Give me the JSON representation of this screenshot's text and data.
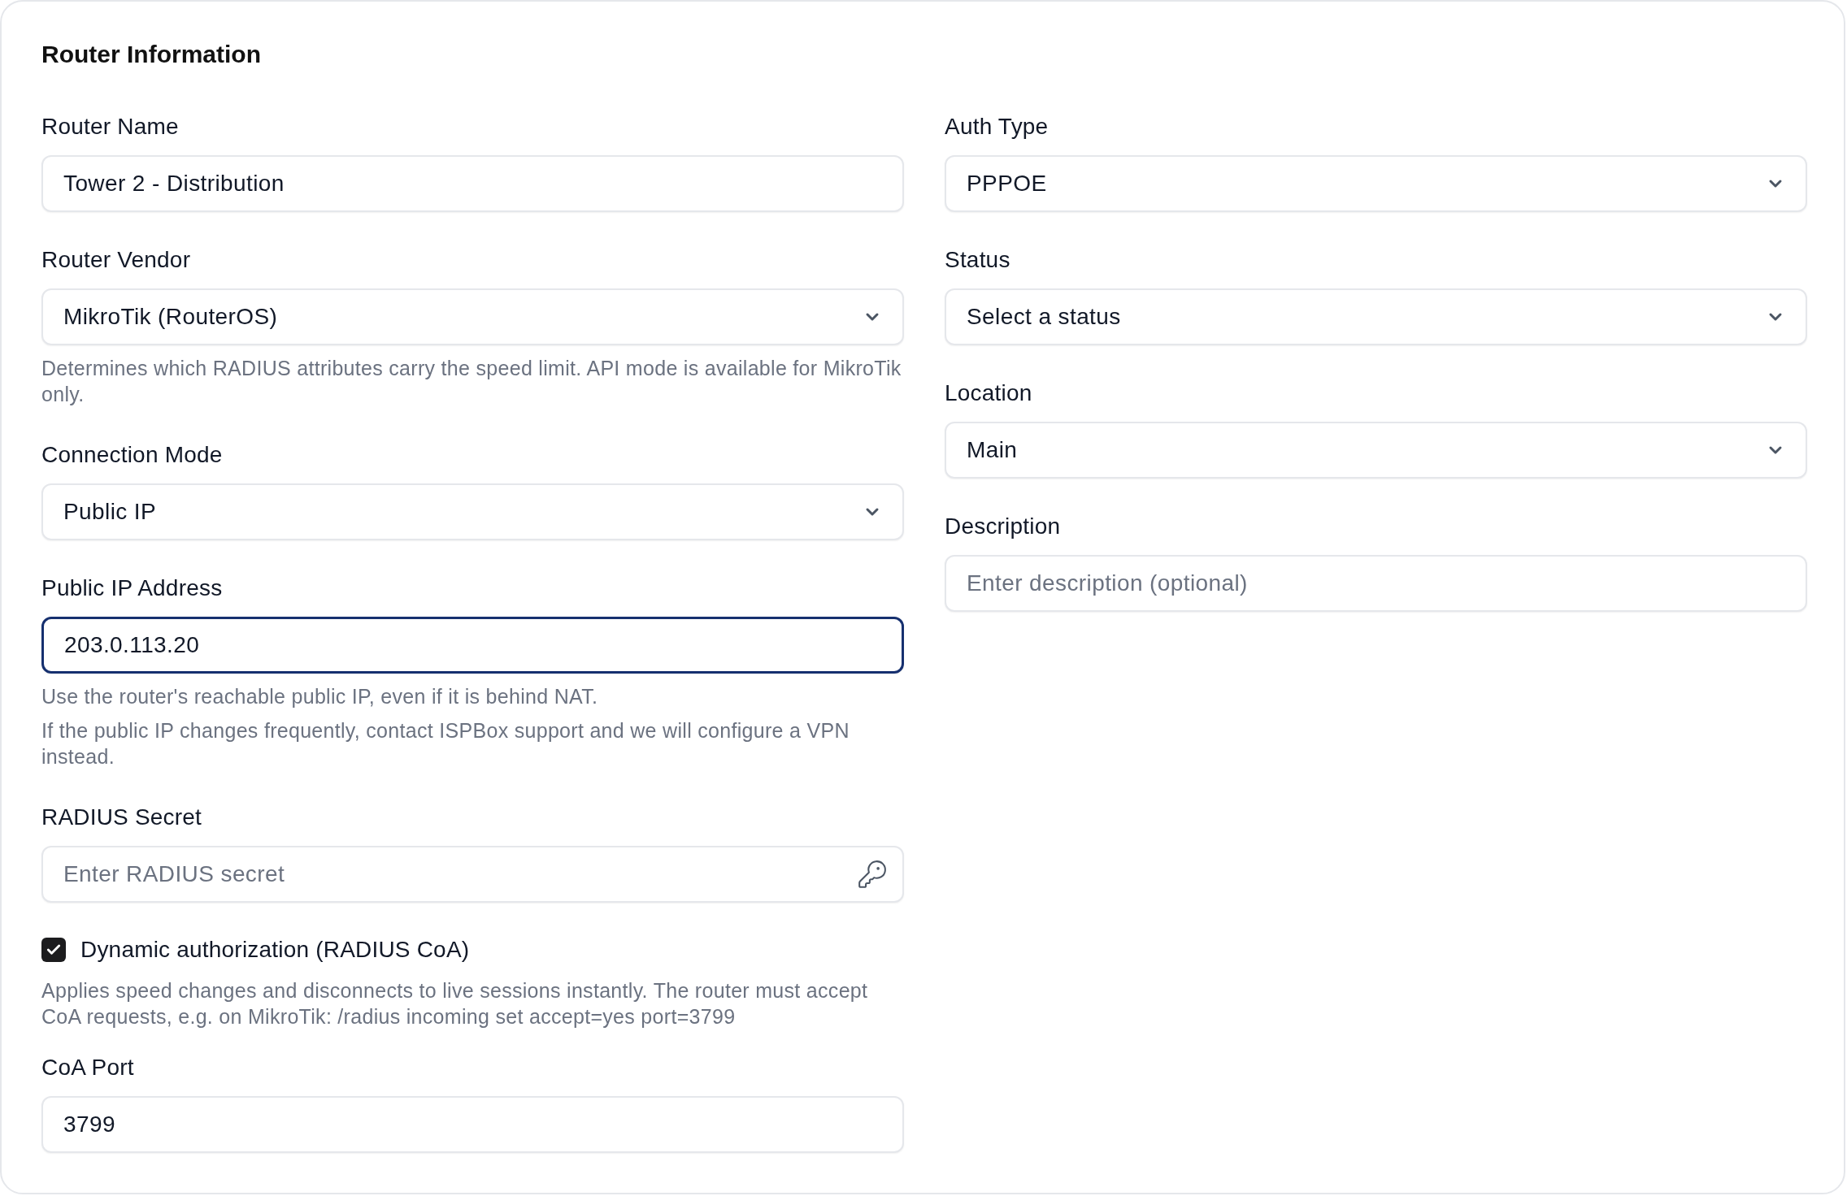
{
  "form": {
    "title": "Router Information",
    "left_column": [
      {
        "kind": "text",
        "label": "Router Name",
        "value": "Tower 2 - Distribution",
        "focused": false
      },
      {
        "kind": "select",
        "label": "Router Vendor",
        "value": "MikroTik (RouterOS)",
        "focused": false,
        "help": [
          "Determines which RADIUS attributes carry the speed limit. API mode is available for MikroTik only."
        ]
      },
      {
        "kind": "select",
        "label": "Connection Mode",
        "value": "Public IP",
        "focused": false
      },
      {
        "kind": "text",
        "label": "Public IP Address",
        "value": "203.0.113.20",
        "focused": true,
        "help": [
          "Use the router's reachable public IP, even if it is behind NAT.",
          "If the public IP changes frequently, contact ISPBox support and we will configure a VPN instead."
        ]
      },
      {
        "kind": "secret",
        "label": "RADIUS Secret",
        "placeholder": "Enter RADIUS secret",
        "focused": false
      },
      {
        "kind": "checkbox",
        "label": "Dynamic authorization (RADIUS CoA)",
        "checked": true,
        "help": [
          "Applies speed changes and disconnects to live sessions instantly. The router must accept CoA requests, e.g. on MikroTik: /radius incoming set accept=yes port=3799"
        ]
      },
      {
        "kind": "text",
        "label": "CoA Port",
        "value": "3799",
        "focused": false
      }
    ],
    "right_column": [
      {
        "kind": "select",
        "label": "Auth Type",
        "value": "PPPOE",
        "focused": false
      },
      {
        "kind": "select",
        "label": "Status",
        "value": "Select a status",
        "focused": false
      },
      {
        "kind": "select",
        "label": "Location",
        "value": "Main",
        "focused": false
      },
      {
        "kind": "text",
        "label": "Description",
        "placeholder": "Enter description (optional)",
        "focused": false
      }
    ]
  }
}
